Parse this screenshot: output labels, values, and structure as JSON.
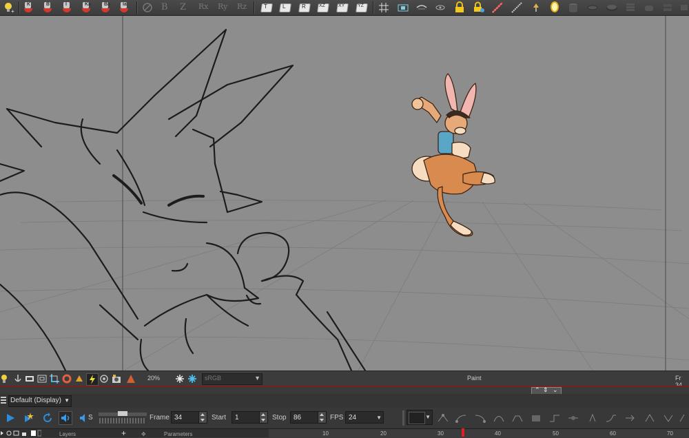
{
  "toolbar": {
    "brush_tools": [
      {
        "name": "brush-K",
        "letter": "K"
      },
      {
        "name": "brush-B",
        "letter": "B"
      },
      {
        "name": "brush-I",
        "letter": "I"
      },
      {
        "name": "brush-Ka",
        "letter": "Ka"
      },
      {
        "name": "brush-Ba",
        "letter": "Ba"
      },
      {
        "name": "brush-Ia",
        "letter": "Ia"
      }
    ],
    "ghost_tools": [
      "B",
      "Z",
      "Rx",
      "Ry",
      "Rz"
    ],
    "camera_views": [
      "T",
      "L",
      "R",
      "XZ",
      "XY",
      "YZ"
    ]
  },
  "status_bar": {
    "zoom": "20%",
    "color_space": "sRGB",
    "mode": "Paint",
    "frame_indicator": "Fr 34"
  },
  "timeline": {
    "view_mode": "Default (Display)",
    "frame_label": "Frame",
    "frame_value": "34",
    "start_label": "Start",
    "start_value": "1",
    "stop_label": "Stop",
    "stop_value": "86",
    "fps_label": "FPS",
    "fps_value": "24",
    "sound_scrub": "S"
  },
  "layers_panel": {
    "layers_label": "Layers",
    "add_symbol": "+",
    "parameters_label": "Parameters"
  },
  "ruler": {
    "ticks": [
      "10",
      "20",
      "30",
      "40",
      "50",
      "60",
      "70"
    ],
    "current_frame": 34
  },
  "colors": {
    "accent_red": "#d23a2e",
    "viewport_bg": "#8d8d8d",
    "playhead": "#e02020",
    "play_blue": "#2e8bd8"
  }
}
